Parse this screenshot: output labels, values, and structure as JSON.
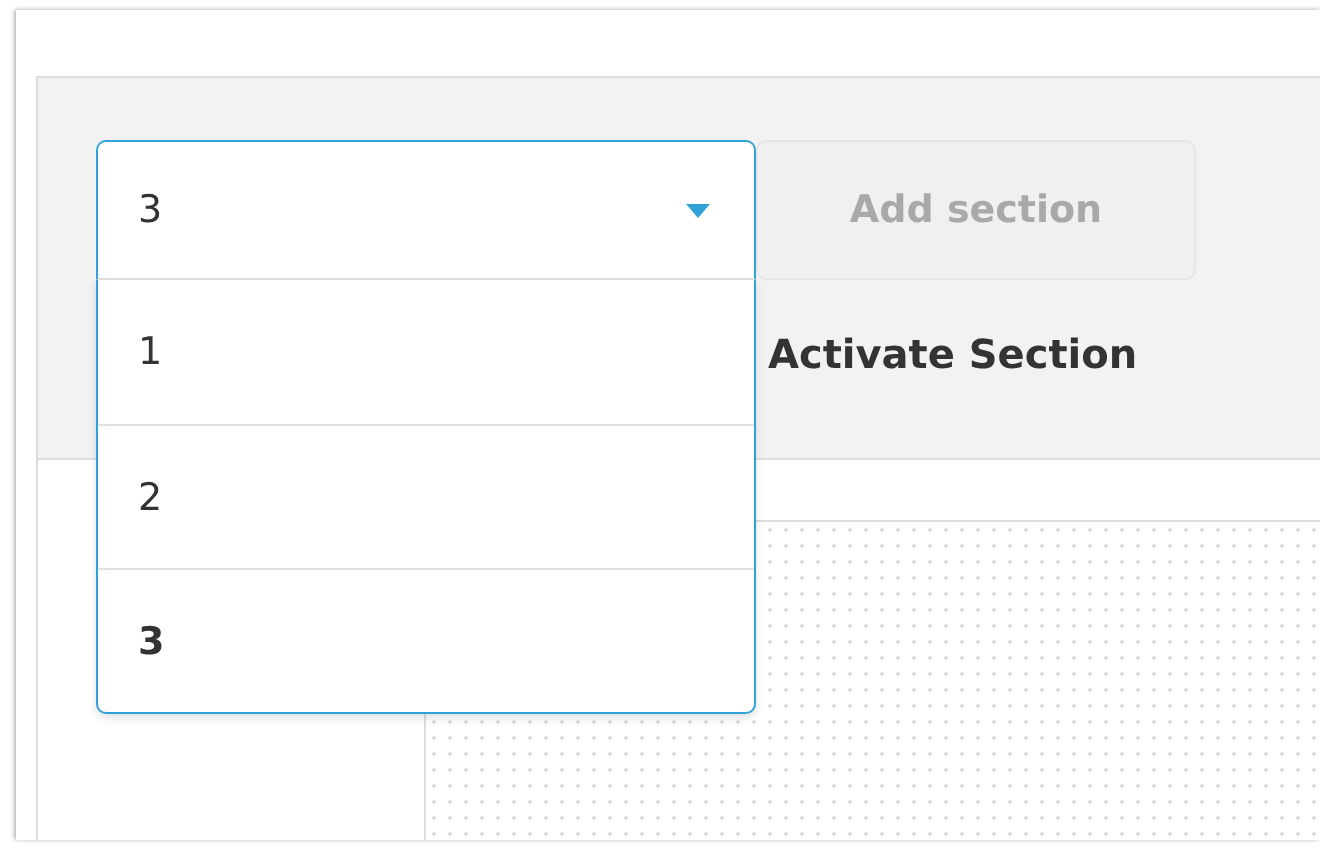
{
  "section_select": {
    "value": "3",
    "expanded": true,
    "options": [
      {
        "label": "1",
        "selected": false
      },
      {
        "label": "2",
        "selected": false
      },
      {
        "label": "3",
        "selected": true
      }
    ]
  },
  "add_section_button": {
    "label": "Add section",
    "disabled": true
  },
  "activate_label": "Activate Section"
}
